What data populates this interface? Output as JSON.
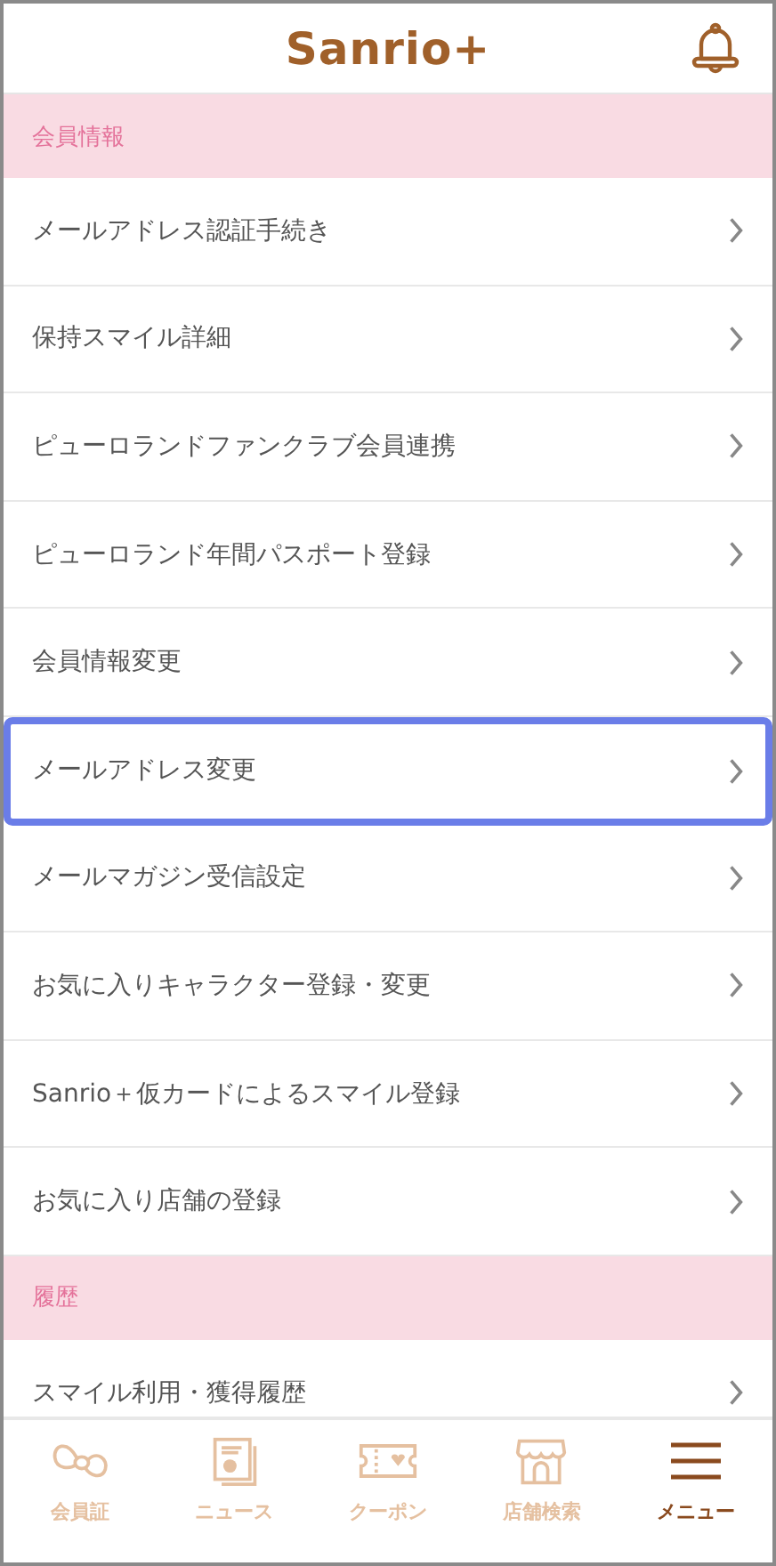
{
  "header": {
    "logo": "Sanrio+"
  },
  "sections": [
    {
      "title": "会員情報",
      "items": [
        {
          "label": "メールアドレス認証手続き",
          "selected": false
        },
        {
          "label": "保持スマイル詳細",
          "selected": false
        },
        {
          "label": "ピューロランドファンクラブ会員連携",
          "selected": false
        },
        {
          "label": "ピューロランド年間パスポート登録",
          "selected": false
        },
        {
          "label": "会員情報変更",
          "selected": false
        },
        {
          "label": "メールアドレス変更",
          "selected": true
        },
        {
          "label": "メールマガジン受信設定",
          "selected": false
        },
        {
          "label": "お気に入りキャラクター登録・変更",
          "selected": false
        },
        {
          "label": "Sanrio＋仮カードによるスマイル登録",
          "selected": false
        },
        {
          "label": "お気に入り店舗の登録",
          "selected": false
        }
      ]
    },
    {
      "title": "履歴",
      "items": [
        {
          "label": "スマイル利用・獲得履歴",
          "selected": false
        }
      ]
    }
  ],
  "nav": [
    {
      "kind": "bow",
      "label": "会員証",
      "selected": false
    },
    {
      "kind": "news",
      "label": "ニュース",
      "selected": false
    },
    {
      "kind": "coupon",
      "label": "クーポン",
      "selected": false
    },
    {
      "kind": "shop",
      "label": "店舗検索",
      "selected": false
    },
    {
      "kind": "menu",
      "label": "メニュー",
      "selected": true
    }
  ]
}
